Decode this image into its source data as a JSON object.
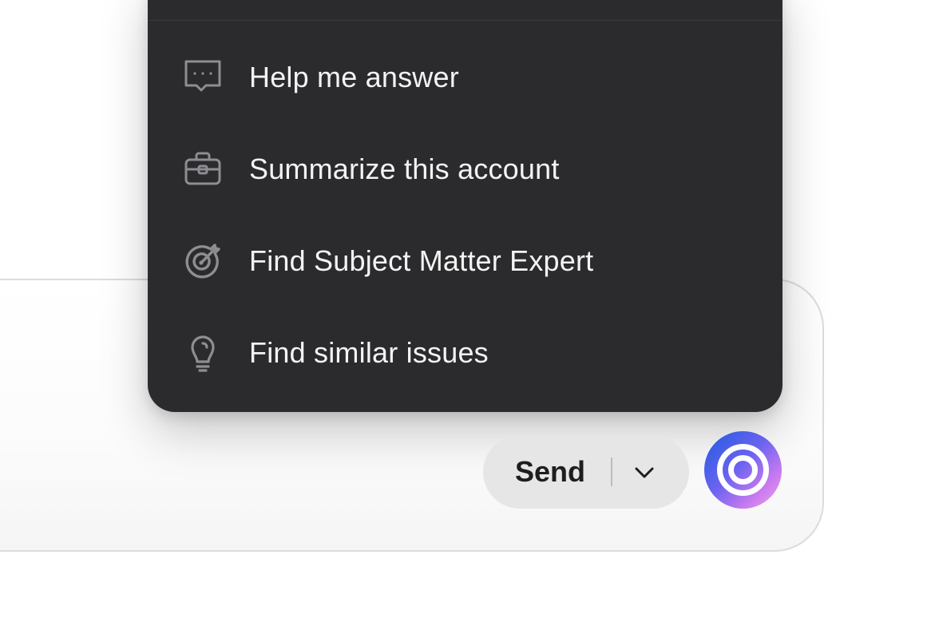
{
  "menu": {
    "items": [
      {
        "label": "Help me answer",
        "icon": "chat-bubble-dots-icon"
      },
      {
        "label": "Summarize this account",
        "icon": "briefcase-icon"
      },
      {
        "label": "Find Subject Matter Expert",
        "icon": "target-arrow-icon"
      },
      {
        "label": "Find similar issues",
        "icon": "lightbulb-icon"
      }
    ]
  },
  "composer": {
    "send_label": "Send",
    "send_dropdown_icon": "chevron-down-icon",
    "ai_button_icon": "concentric-circles-icon"
  },
  "colors": {
    "menu_background": "#2b2b2d",
    "menu_text": "#f3f3f3",
    "menu_icon": "#8e8e92",
    "send_button_background": "#e6e6e6",
    "orb_gradient_start": "#1f5be0",
    "orb_gradient_end": "#f2a0e8"
  }
}
